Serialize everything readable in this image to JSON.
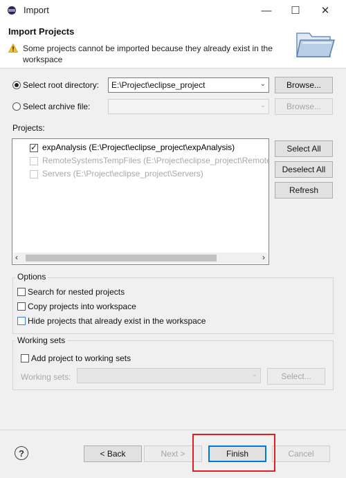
{
  "window": {
    "title": "Import",
    "minimize_label": "—",
    "maximize_label": "☐",
    "close_label": "✕"
  },
  "header": {
    "title": "Import Projects",
    "message": "Some projects cannot be imported because they already exist in the workspace"
  },
  "source": {
    "root_directory_label": "Select root directory:",
    "root_directory_value": "E:\\Project\\eclipse_project",
    "root_selected": true,
    "archive_file_label": "Select archive file:",
    "archive_file_value": "",
    "archive_selected": false,
    "browse_label": "Browse...",
    "browse_archive_label": "Browse..."
  },
  "projects": {
    "label": "Projects:",
    "items": [
      {
        "label": "expAnalysis (E:\\Project\\eclipse_project\\expAnalysis)",
        "checked": true,
        "enabled": true
      },
      {
        "label": "RemoteSystemsTempFiles (E:\\Project\\eclipse_project\\RemoteSystemsTempFiles)",
        "checked": false,
        "enabled": false
      },
      {
        "label": "Servers (E:\\Project\\eclipse_project\\Servers)",
        "checked": false,
        "enabled": false
      }
    ],
    "select_all_label": "Select All",
    "deselect_all_label": "Deselect All",
    "refresh_label": "Refresh",
    "scroll_left": "‹",
    "scroll_right": "›"
  },
  "options": {
    "title": "Options",
    "search_nested_label": "Search for nested projects",
    "search_nested_checked": false,
    "copy_projects_label": "Copy projects into workspace",
    "copy_projects_checked": false,
    "hide_existing_label": "Hide projects that already exist in the workspace",
    "hide_existing_checked": false
  },
  "working_sets": {
    "title": "Working sets",
    "add_label": "Add project to working sets",
    "add_checked": false,
    "field_label": "Working sets:",
    "select_label": "Select..."
  },
  "footer": {
    "help_label": "?",
    "back_label": "< Back",
    "next_label": "Next >",
    "finish_label": "Finish",
    "cancel_label": "Cancel"
  },
  "colors": {
    "highlight": "#e02020",
    "warning": "#f2c12e"
  }
}
